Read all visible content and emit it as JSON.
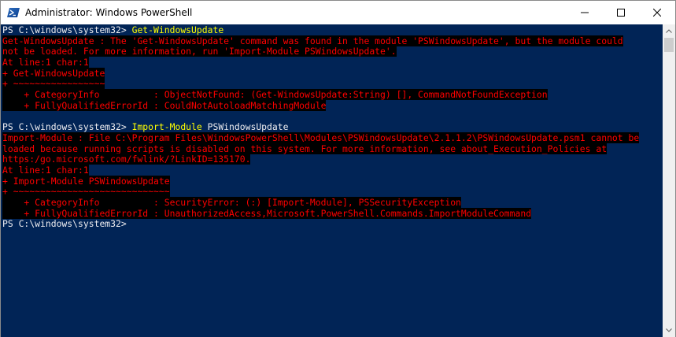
{
  "window": {
    "title": "Administrator: Windows PowerShell",
    "icon": "powershell-icon",
    "controls": {
      "minimize": "minimize-icon",
      "maximize": "maximize-icon",
      "close": "close-icon"
    }
  },
  "colors": {
    "console_bg": "#012456",
    "prompt_text": "#eeedf0",
    "command_text": "#ffff00",
    "error_text": "#ff0000",
    "error_bg": "#000000"
  },
  "console": {
    "line1": {
      "prompt": "PS C:\\windows\\system32> ",
      "command": "Get-WindowsUpdate"
    },
    "line2": "Get-WindowsUpdate : The 'Get-WindowsUpdate' command was found in the module 'PSWindowsUpdate', but the module could",
    "line3": "not be loaded. For more information, run 'Import-Module PSWindowsUpdate'.",
    "line4": "At line:1 char:1",
    "line5": "+ Get-WindowsUpdate",
    "line6": "+ ~~~~~~~~~~~~~~~~~",
    "line7": "    + CategoryInfo          : ObjectNotFound: (Get-WindowsUpdate:String) [], CommandNotFoundException",
    "line8": "    + FullyQualifiedErrorId : CouldNotAutoloadMatchingModule",
    "line9": "",
    "line10": {
      "prompt": "PS C:\\windows\\system32> ",
      "command_name": "Import-Module",
      "command_arg": " PSWindowsUpdate"
    },
    "line11": "Import-Module : File C:\\Program Files\\WindowsPowerShell\\Modules\\PSWindowsUpdate\\2.1.1.2\\PSWindowsUpdate.psm1 cannot be",
    "line12": "loaded because running scripts is disabled on this system. For more information, see about_Execution_Policies at",
    "line13": "https:/go.microsoft.com/fwlink/?LinkID=135170.",
    "line14": "At line:1 char:1",
    "line15": "+ Import-Module PSWindowsUpdate",
    "line16": "+ ~~~~~~~~~~~~~~~~~~~~~~~~~~~~~",
    "line17": "    + CategoryInfo          : SecurityError: (:) [Import-Module], PSSecurityException",
    "line18": "    + FullyQualifiedErrorId : UnauthorizedAccess,Microsoft.PowerShell.Commands.ImportModuleCommand",
    "line19": {
      "prompt": "PS C:\\windows\\system32>"
    }
  },
  "scrollbar": {
    "up": "scroll-up-arrow-icon",
    "down": "scroll-down-arrow-icon"
  }
}
